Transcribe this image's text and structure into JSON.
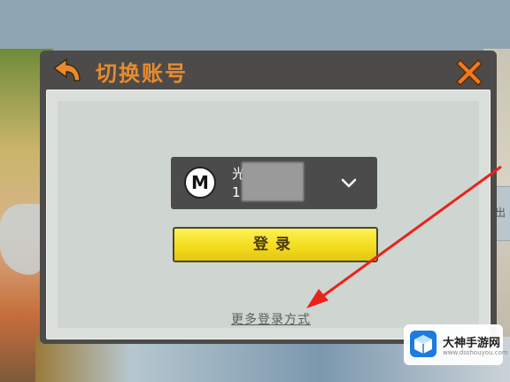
{
  "dialog": {
    "title": "切换账号",
    "back_icon": "back-arrow-icon",
    "close_icon": "close-x-icon",
    "accent_color": "#e98b2c"
  },
  "account": {
    "avatar_letter": "M",
    "name": "光 夏",
    "number": "1 4",
    "dropdown_icon": "chevron-down-icon"
  },
  "login": {
    "label": "登录",
    "color": "#f4dd1e"
  },
  "more_login": {
    "label": "更多登录方式"
  },
  "side_tab": {
    "label": "出"
  },
  "watermark": {
    "title": "大神手游网",
    "url": "www.dsshouyou.com",
    "logo_icon": "cube-logo-icon"
  },
  "annotation": {
    "arrow_color": "#e8231c"
  }
}
